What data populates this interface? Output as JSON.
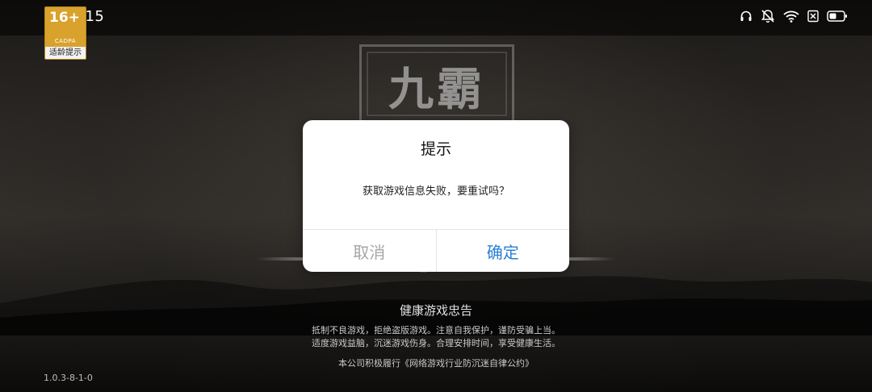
{
  "status_bar": {
    "time": "13:15",
    "icons": [
      "headset-icon",
      "mute-icon",
      "wifi-icon",
      "sim-off-icon",
      "battery-icon"
    ]
  },
  "age_rating": {
    "age": "16+",
    "org": "CADPA",
    "tip": "适龄提示",
    "color": "#d9a22c"
  },
  "logo": {
    "text": "九霸"
  },
  "dialog": {
    "title": "提示",
    "message": "获取游戏信息失败，要重试吗？",
    "cancel_label": "取消",
    "confirm_label": "确定",
    "confirm_color": "#2a7fd4"
  },
  "health_notice": {
    "title": "健康游戏忠告",
    "lines": [
      "抵制不良游戏，拒绝盗版游戏。注意自我保护，谨防受骗上当。",
      "适度游戏益脑，沉迷游戏伤身。合理安排时间，享受健康生活。"
    ],
    "pledge": "本公司积极履行《网络游戏行业防沉迷自律公约》"
  },
  "version": "1.0.3-8-1-0"
}
